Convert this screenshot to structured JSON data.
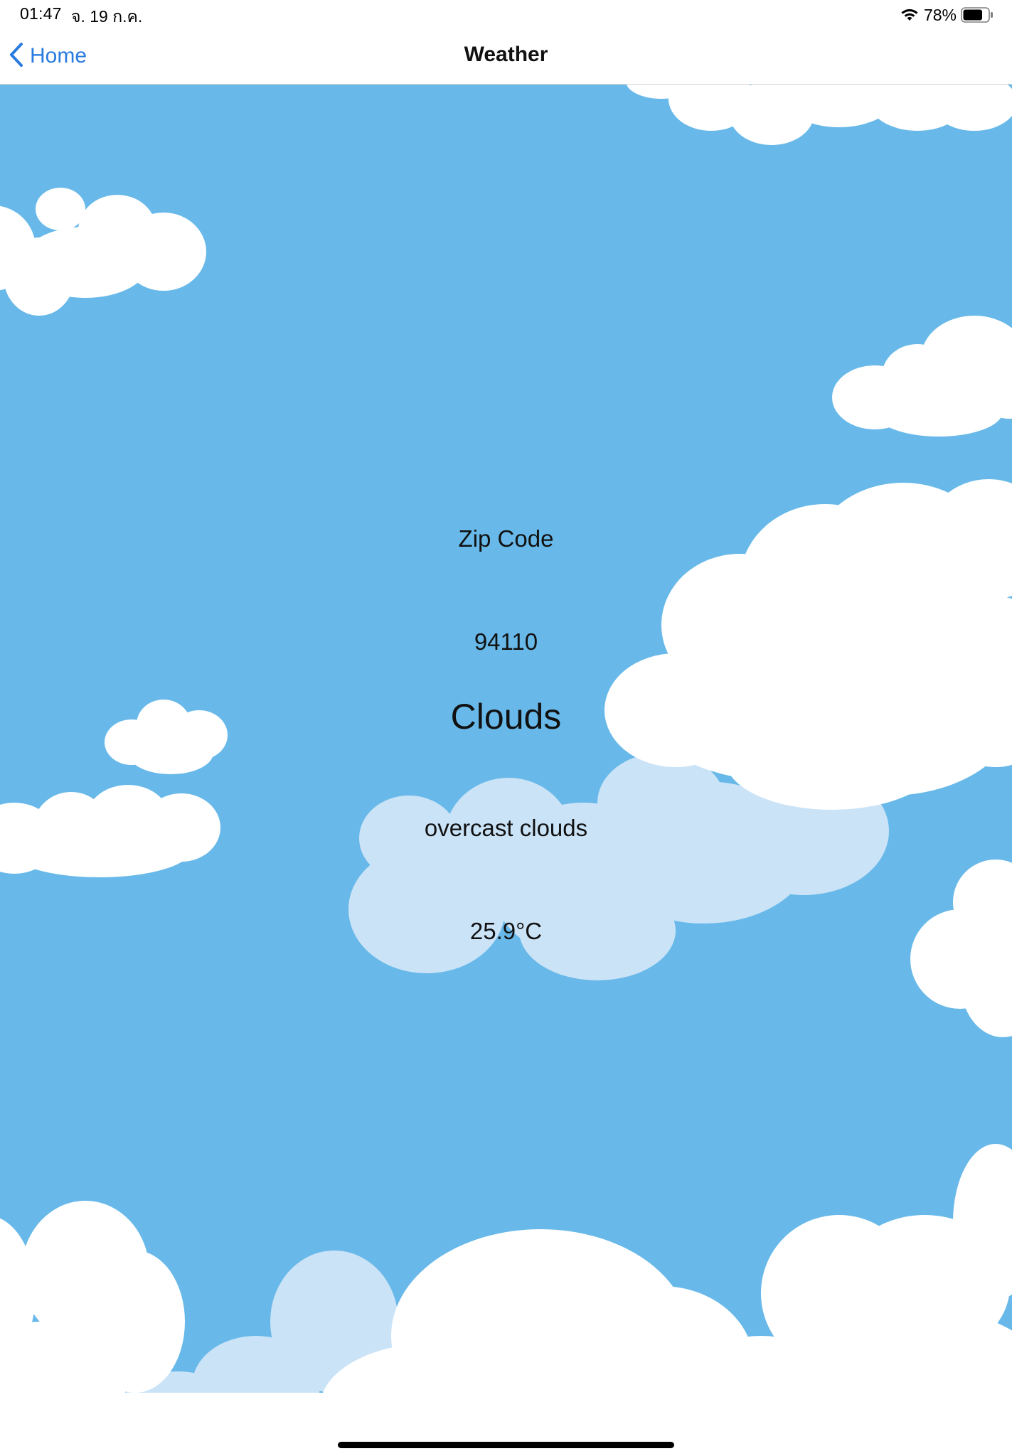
{
  "status_bar": {
    "time": "01:47",
    "date": "จ. 19 ก.ค.",
    "battery_percent": "78%",
    "battery_level": 0.78,
    "icons": [
      "wifi-icon",
      "battery-icon"
    ]
  },
  "nav": {
    "back_label": "Home",
    "back_icon": "chevron-left-icon",
    "title": "Weather"
  },
  "weather": {
    "zip_label": "Zip Code",
    "zip_value": "94110",
    "condition": "Clouds",
    "description": "overcast clouds",
    "temperature": "25.9°C"
  },
  "colors": {
    "accent": "#2a7be0",
    "sky": "#68b9e9",
    "cloud": "#ffffff",
    "cloud_light": "#cbe3f7"
  }
}
